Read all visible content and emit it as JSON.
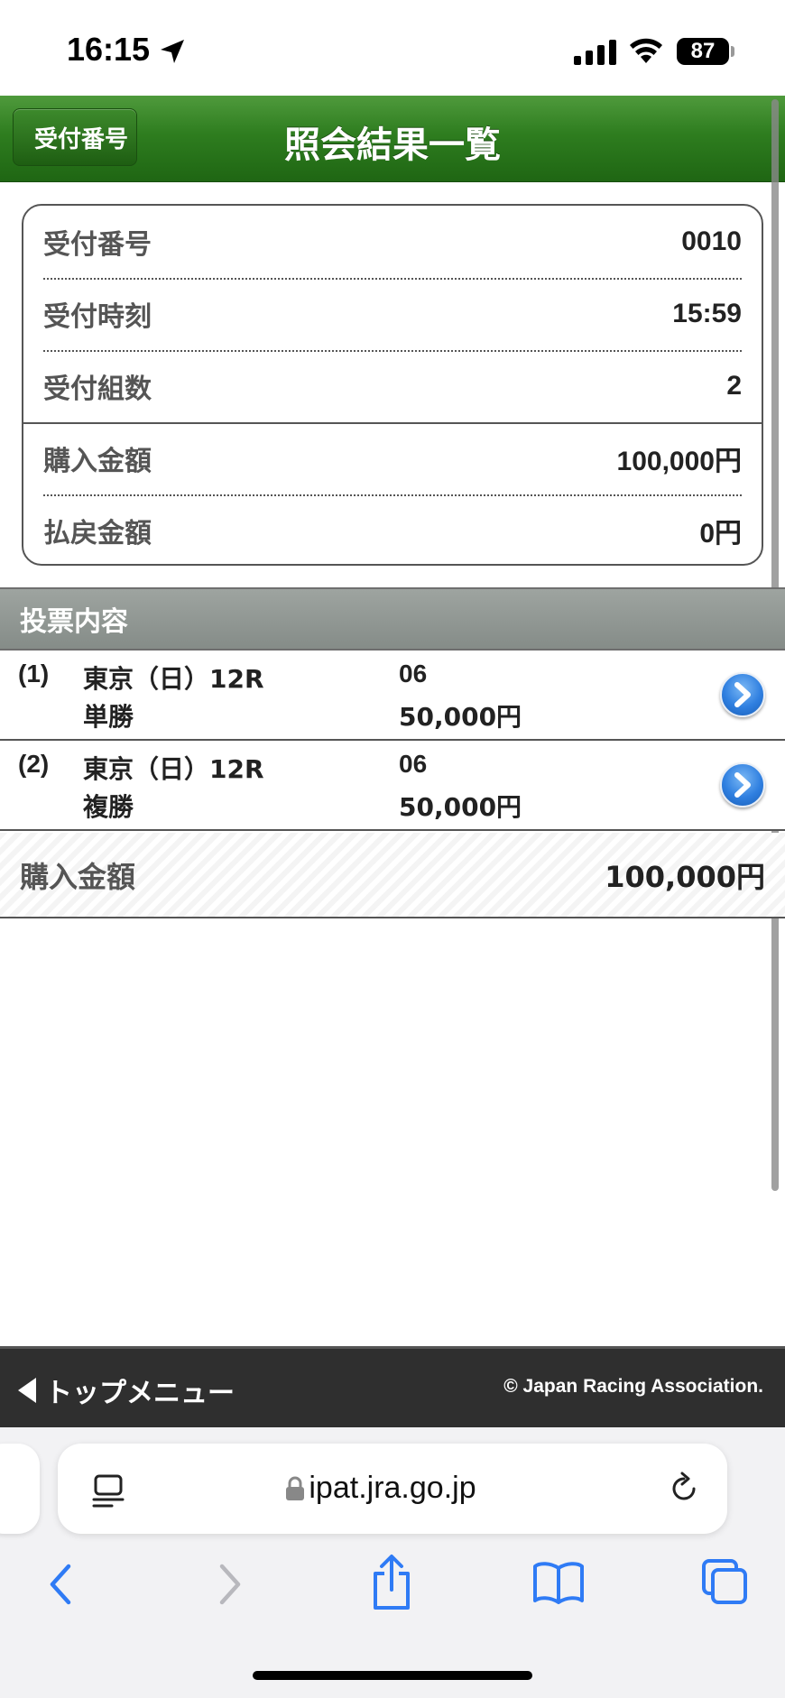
{
  "status_bar": {
    "time": "16:15",
    "battery": "87"
  },
  "header": {
    "back_label": "受付番号",
    "title": "照会結果一覧",
    "accent_color": "#2e7d1f"
  },
  "summary": {
    "rows": [
      {
        "label": "受付番号",
        "value": "0010"
      },
      {
        "label": "受付時刻",
        "value": "15:59"
      },
      {
        "label": "受付組数",
        "value": "2"
      },
      {
        "label": "購入金額",
        "value": "100,000円"
      },
      {
        "label": "払戻金額",
        "value": "0円"
      }
    ]
  },
  "section": {
    "title": "投票内容"
  },
  "bets": [
    {
      "num": "(1)",
      "race": "東京（日）12R",
      "type": "単勝",
      "horse": "06",
      "amount": "50,000円"
    },
    {
      "num": "(2)",
      "race": "東京（日）12R",
      "type": "複勝",
      "horse": "06",
      "amount": "50,000円"
    }
  ],
  "total": {
    "label": "購入金額",
    "value": "100,000円"
  },
  "footer": {
    "top_menu": "トップメニュー",
    "copyright": "© Japan Racing Association."
  },
  "browser": {
    "url": "ipat.jra.go.jp",
    "icons": [
      "reader-icon",
      "lock-icon",
      "reload-icon",
      "back-icon",
      "forward-icon",
      "share-icon",
      "bookmarks-icon",
      "tabs-icon"
    ]
  }
}
